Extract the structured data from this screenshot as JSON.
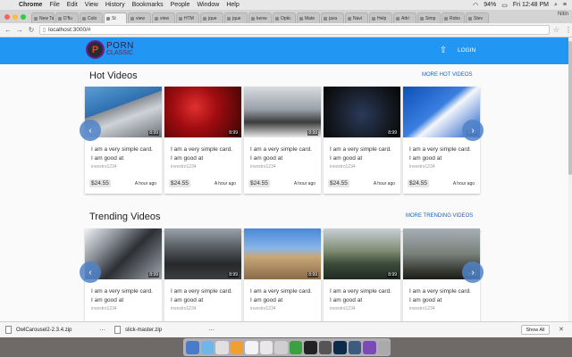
{
  "menubar": {
    "app": "Chrome",
    "items": [
      "File",
      "Edit",
      "View",
      "History",
      "Bookmarks",
      "People",
      "Window",
      "Help"
    ],
    "battery": "94%",
    "clock": "Fri 12:48 PM"
  },
  "tabs": [
    "New Tab",
    "D'flu",
    "Colo",
    "St",
    "view",
    "view",
    "HTM",
    "jque",
    "jque",
    "kenw",
    "Optic",
    "Mate",
    "java",
    "Navi",
    "Help",
    "Attri",
    "Simp",
    "Robo",
    "Stev"
  ],
  "profile": "Nitin",
  "address": {
    "url": "localhost:3000/#"
  },
  "header": {
    "logo_top": "PORN",
    "logo_bottom": "CLASSIC",
    "logo_mark": "P",
    "login": "LOGIN"
  },
  "sections": [
    {
      "title": "Hot Videos",
      "link": "MORE HOT VIDEOS",
      "cards": [
        {
          "line1": "I am a very simple card.",
          "line2": "I am good at",
          "author": "investro1234",
          "duration": "8:99",
          "price": "$24.55",
          "time": "A hour ago"
        },
        {
          "line1": "I am a very simple card.",
          "line2": "I am good at",
          "author": "investro1234",
          "duration": "8:99",
          "price": "$24.55",
          "time": "A hour ago"
        },
        {
          "line1": "I am a very simple card.",
          "line2": "I am good at",
          "author": "investro1234",
          "duration": "8:99",
          "price": "$24.55",
          "time": "A hour ago"
        },
        {
          "line1": "I am a very simple card.",
          "line2": "I am good at",
          "author": "investro1234",
          "duration": "8:99",
          "price": "$24.55",
          "time": "A hour ago"
        },
        {
          "line1": "I am a very simple card.",
          "line2": "I am good at",
          "author": "investro1234",
          "duration": "8:99",
          "price": "$24.55",
          "time": "A hour ago"
        }
      ]
    },
    {
      "title": "Trending Videos",
      "link": "MORE TRENDING VIDEOS",
      "cards": [
        {
          "line1": "I am a very simple card.",
          "line2": "I am good at",
          "author": "investro1234",
          "duration": "8:99",
          "price": "",
          "time": ""
        },
        {
          "line1": "I am a very simple card.",
          "line2": "I am good at",
          "author": "investro1234",
          "duration": "8:99",
          "price": "",
          "time": ""
        },
        {
          "line1": "I am a very simple card.",
          "line2": "I am good at",
          "author": "investro1234",
          "duration": "8:99",
          "price": "",
          "time": ""
        },
        {
          "line1": "I am a very simple card.",
          "line2": "I am good at",
          "author": "investro1234",
          "duration": "8:99",
          "price": "",
          "time": ""
        },
        {
          "line1": "I am a very simple card.",
          "line2": "I am good at",
          "author": "investro1234",
          "duration": "8:99",
          "price": "",
          "time": ""
        }
      ]
    }
  ],
  "downloads": {
    "files": [
      "OwlCarousel2-2.3.4.zip",
      "slick-master.zip"
    ],
    "show_all": "Show All"
  },
  "icons": {
    "upload": "upload-icon",
    "prev": "chevron-left-icon",
    "next": "chevron-right-icon"
  },
  "colors": {
    "appbar": "#2196f3",
    "link": "#1e64b4"
  }
}
